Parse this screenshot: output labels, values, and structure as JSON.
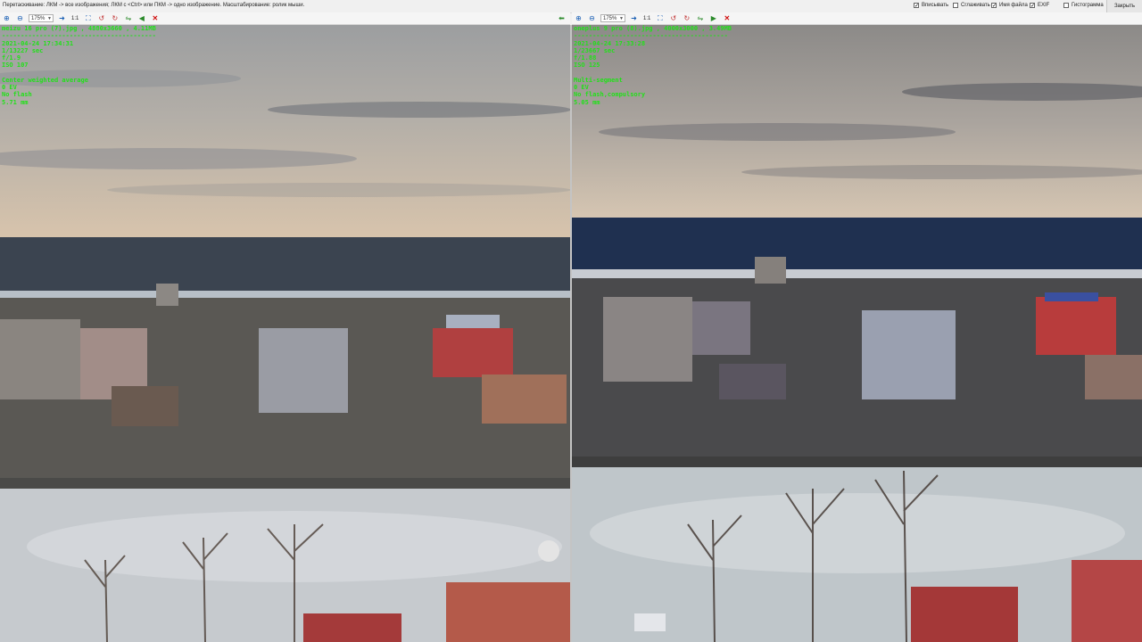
{
  "window": {
    "hint": "Перетаскивание: ЛКМ -> все изображения; ЛКМ с <Ctrl> или ПКМ -> одно изображение. Масштабирование: ролик мыши.",
    "options": [
      {
        "label": "Вписывать",
        "checked": true
      },
      {
        "label": "Сглаживать",
        "checked": false
      },
      {
        "label": "Имя файла",
        "checked": true
      },
      {
        "label": "EXIF",
        "checked": true
      },
      {
        "label": "Гистограмма",
        "checked": false
      }
    ],
    "close_label": "Закрыть"
  },
  "toolbar": {
    "zoom_value": "175%",
    "ratio_label": "1:1"
  },
  "panes": [
    {
      "filename_line": "meizu 16 pro (7).jpg , 4880x3660 , 4.11MB",
      "separator": "-----------------------------------------",
      "datetime": "2021-04-24 17:34:31",
      "exposure": "1/13227 sec",
      "fnumber": "f/1.9",
      "iso": "ISO 107",
      "metering": "Center weighted average",
      "ev": "0 EV",
      "flash": "No flash",
      "focal": "5.71 mm"
    },
    {
      "filename_line": "oneplus 9 pro (8).jpg , 4000x3000 , 3.49MB",
      "separator": "-----------------------------------------",
      "datetime": "2021-04-24 17:33:28",
      "exposure": "1/23667 sec",
      "fnumber": "f/1.88",
      "iso": "ISO 125",
      "metering": "Multi-segment",
      "ev": "0 EV",
      "flash": "No flash,compulsory",
      "focal": "5.05 mm"
    }
  ],
  "icons": [
    "zoom-in-icon",
    "zoom-out-icon",
    "zoom-select",
    "next-arrow-icon",
    "ratio-1-1",
    "fit-icon",
    "rotate-left-icon",
    "rotate-right-icon",
    "flip-icon",
    "prev-icon",
    "next-icon",
    "close-icon",
    "sync-arrow-icon"
  ]
}
